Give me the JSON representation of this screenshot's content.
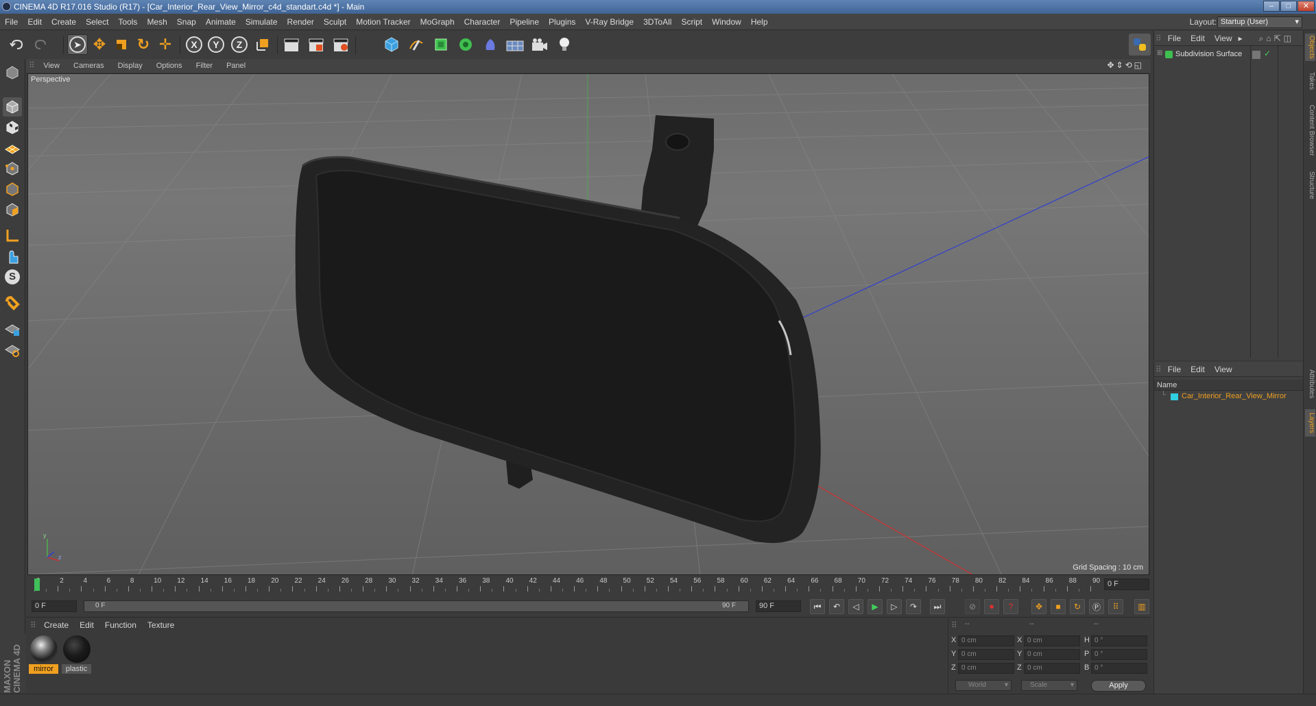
{
  "window": {
    "title": "CINEMA 4D R17.016 Studio (R17) - [Car_Interior_Rear_View_Mirror_c4d_standart.c4d *] - Main",
    "buttons": [
      "–",
      "□",
      "✕"
    ]
  },
  "menubar": {
    "items": [
      "File",
      "Edit",
      "Create",
      "Select",
      "Tools",
      "Mesh",
      "Snap",
      "Animate",
      "Simulate",
      "Render",
      "Sculpt",
      "Motion Tracker",
      "MoGraph",
      "Character",
      "Pipeline",
      "Plugins",
      "V-Ray Bridge",
      "3DToAll",
      "Script",
      "Window",
      "Help"
    ],
    "layout_label": "Layout:",
    "layout_value": "Startup (User)"
  },
  "toolbar": {
    "axis_x": "X",
    "axis_y": "Y",
    "axis_z": "Z"
  },
  "viewport": {
    "menu": [
      "View",
      "Cameras",
      "Display",
      "Options",
      "Filter",
      "Panel"
    ],
    "label": "Perspective",
    "grid_spacing": "Grid Spacing : 10 cm",
    "axis_y": "y",
    "axis_z": "z"
  },
  "timeline": {
    "ticks": [
      "0",
      "2",
      "4",
      "6",
      "8",
      "10",
      "12",
      "14",
      "16",
      "18",
      "20",
      "22",
      "24",
      "26",
      "28",
      "30",
      "32",
      "34",
      "36",
      "38",
      "40",
      "42",
      "44",
      "46",
      "48",
      "50",
      "52",
      "54",
      "56",
      "58",
      "60",
      "62",
      "64",
      "66",
      "68",
      "70",
      "72",
      "74",
      "76",
      "78",
      "80",
      "82",
      "84",
      "86",
      "88",
      "90"
    ],
    "current_frame": "0 F"
  },
  "transport": {
    "start_frame": "0 F",
    "range_start": "0 F",
    "range_end": "90 F",
    "end_frame": "90 F"
  },
  "materials": {
    "menu": [
      "Create",
      "Edit",
      "Function",
      "Texture"
    ],
    "items": [
      {
        "name": "mirror",
        "selected": true
      },
      {
        "name": "plastic",
        "selected": false
      }
    ]
  },
  "coordinates": {
    "header": [
      "--",
      "--",
      "--"
    ],
    "rows": [
      {
        "l1": "X",
        "v1": "0 cm",
        "l2": "X",
        "v2": "0 cm",
        "l3": "H",
        "v3": "0 °"
      },
      {
        "l1": "Y",
        "v1": "0 cm",
        "l2": "Y",
        "v2": "0 cm",
        "l3": "P",
        "v3": "0 °"
      },
      {
        "l1": "Z",
        "v1": "0 cm",
        "l2": "Z",
        "v2": "0 cm",
        "l3": "B",
        "v3": "0 °"
      }
    ],
    "mode": "World",
    "type": "Scale",
    "apply": "Apply"
  },
  "objects_panel": {
    "menu": [
      "File",
      "Edit",
      "View"
    ],
    "items": [
      "Subdivision Surface"
    ]
  },
  "layers_panel": {
    "menu": [
      "File",
      "Edit",
      "View"
    ],
    "column_header": "Name",
    "items": [
      "Car_Interior_Rear_View_Mirror"
    ]
  },
  "side_tabs": [
    "Objects",
    "Takes",
    "Content Browser",
    "Structure",
    "Attributes",
    "Layers"
  ],
  "branding": "MAXON CINEMA 4D",
  "colors": {
    "accent_orange": "#f0a020",
    "layer_cyan": "#30d0e0",
    "title_blue": "#4f74a5"
  }
}
